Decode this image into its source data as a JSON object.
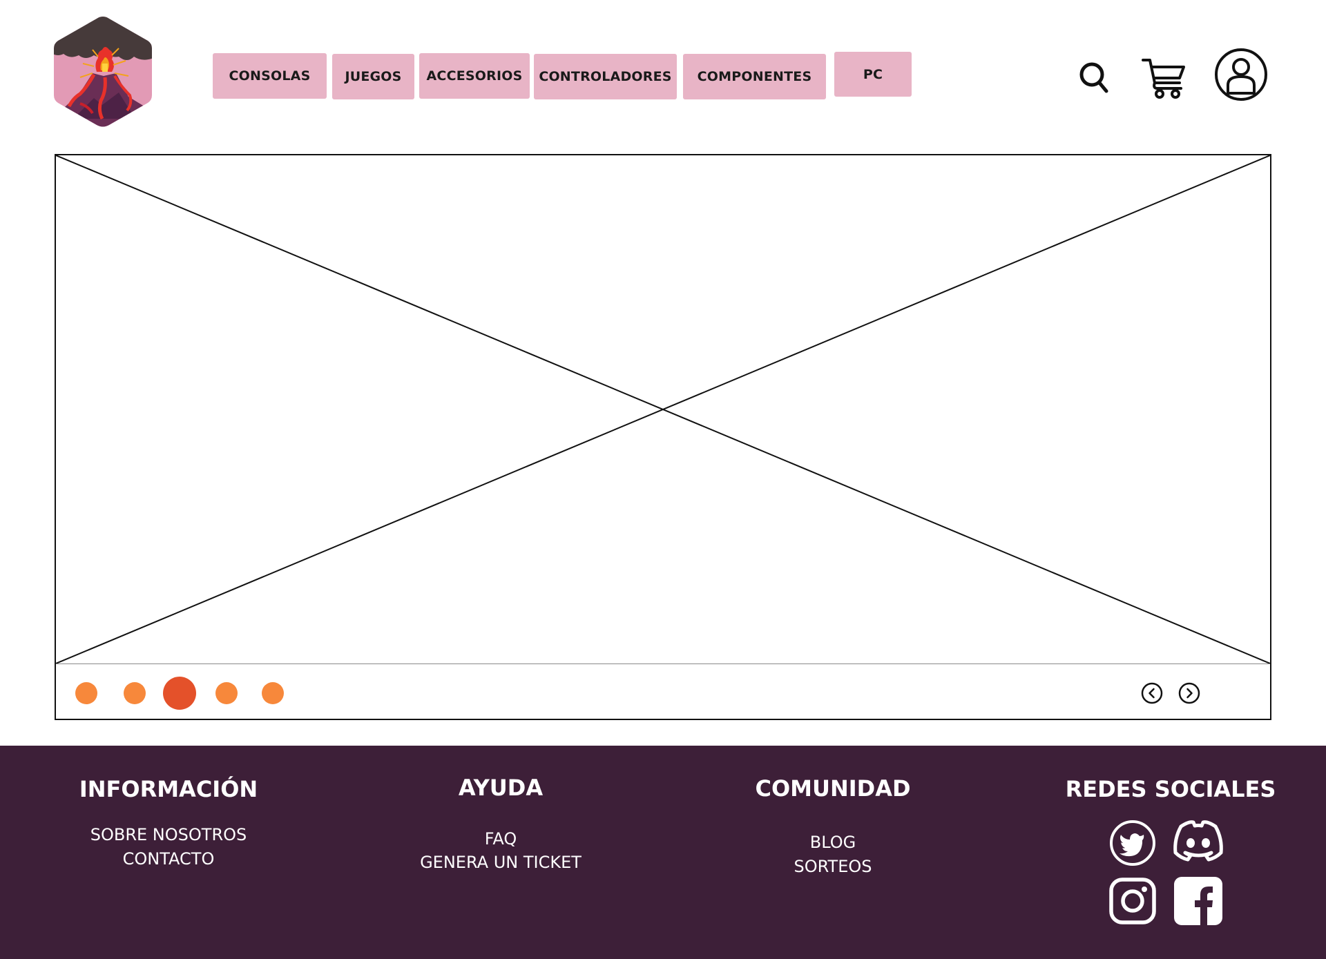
{
  "colors": {
    "nav_pink": "#e8b4c6",
    "footer_bg": "#3d1f38",
    "dot": "#f7883b",
    "dot_active": "#e4512a"
  },
  "header": {
    "logo_icon": "volcano-hexagon-logo",
    "nav": [
      {
        "label": "CONSOLAS"
      },
      {
        "label": "JUEGOS"
      },
      {
        "label": "ACCESORIOS"
      },
      {
        "label": "CONTROLADORES"
      },
      {
        "label": "COMPONENTES"
      },
      {
        "label": "PC"
      }
    ],
    "icons": [
      "search-icon",
      "cart-icon",
      "user-icon"
    ]
  },
  "carousel": {
    "slide_count": 5,
    "active_index": 2,
    "arrows": [
      "chevron-left-icon",
      "chevron-right-icon"
    ]
  },
  "footer": {
    "columns": [
      {
        "title": "INFORMACIÓN",
        "links": [
          "SOBRE NOSOTROS",
          "CONTACTO"
        ]
      },
      {
        "title": "AYUDA",
        "links": [
          "FAQ",
          "GENERA UN TICKET"
        ]
      },
      {
        "title": "COMUNIDAD",
        "links": [
          "BLOG",
          "SORTEOS"
        ]
      },
      {
        "title": "REDES SOCIALES",
        "links": []
      }
    ],
    "social_icons": [
      "twitter-icon",
      "discord-icon",
      "instagram-icon",
      "facebook-icon"
    ]
  }
}
